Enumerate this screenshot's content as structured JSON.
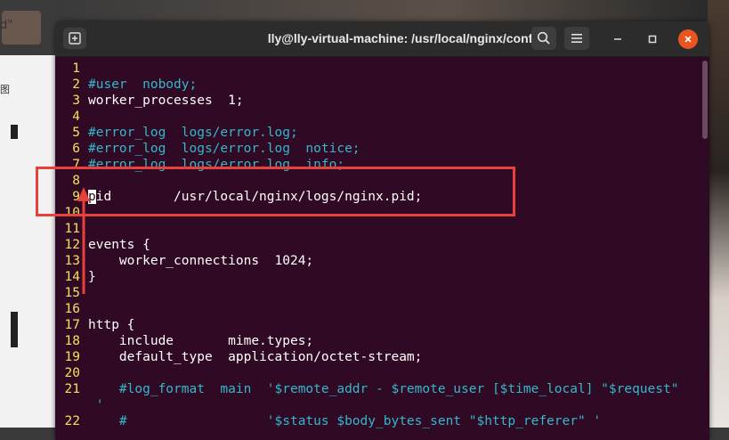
{
  "window": {
    "title": "lly@lly-virtual-machine: /usr/local/nginx/conf",
    "buttons": {
      "new_tab": "new-tab-icon",
      "search": "search-icon",
      "menu": "hamburger-menu-icon",
      "minimize": "minimize-icon",
      "maximize": "maximize-icon",
      "close": "close-icon"
    }
  },
  "background": {
    "left_glyphs": [
      "d\"",
      "图"
    ]
  },
  "editor": {
    "lines": [
      {
        "num": "1",
        "text": "",
        "type": "default"
      },
      {
        "num": "2",
        "text": "#user  nobody;",
        "type": "comment"
      },
      {
        "num": "3",
        "text": "worker_processes  1;",
        "type": "default"
      },
      {
        "num": "4",
        "text": "",
        "type": "default"
      },
      {
        "num": "5",
        "text": "#error_log  logs/error.log;",
        "type": "comment"
      },
      {
        "num": "6",
        "text": "#error_log  logs/error.log  notice;",
        "type": "comment"
      },
      {
        "num": "7",
        "text": "#error_log  logs/error.log  info;",
        "type": "comment"
      },
      {
        "num": "8",
        "text": "",
        "type": "default"
      },
      {
        "num": "9",
        "text": "pid        /usr/local/nginx/logs/nginx.pid;",
        "type": "default",
        "cursor_char": "p",
        "rest": "id        /usr/local/nginx/logs/nginx.pid;"
      },
      {
        "num": "10",
        "text": "",
        "type": "default"
      },
      {
        "num": "11",
        "text": "",
        "type": "default"
      },
      {
        "num": "12",
        "text": "events {",
        "type": "default"
      },
      {
        "num": "13",
        "text": "    worker_connections  1024;",
        "type": "default"
      },
      {
        "num": "14",
        "text": "}",
        "type": "default"
      },
      {
        "num": "15",
        "text": "",
        "type": "default"
      },
      {
        "num": "16",
        "text": "",
        "type": "default"
      },
      {
        "num": "17",
        "text": "http {",
        "type": "default"
      },
      {
        "num": "18",
        "text": "    include       mime.types;",
        "type": "default"
      },
      {
        "num": "19",
        "text": "    default_type  application/octet-stream;",
        "type": "default"
      },
      {
        "num": "20",
        "text": "",
        "type": "default"
      },
      {
        "num": "21",
        "text": "    #log_format  main  '$remote_addr - $remote_user [$time_local] \"$request\"",
        "type": "comment"
      },
      {
        "num": "",
        "text": " '",
        "type": "comment"
      },
      {
        "num": "22",
        "text": "    #                  '$status $body_bytes_sent \"$http_referer\" '",
        "type": "comment"
      }
    ]
  },
  "annotation": {
    "color": "#e8403a",
    "target_line": "9"
  }
}
